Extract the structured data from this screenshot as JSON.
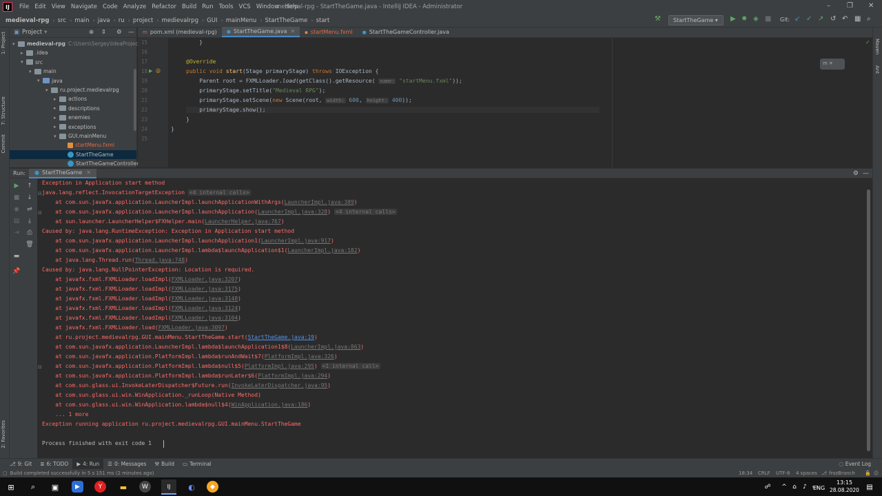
{
  "menubar": {
    "items": [
      "File",
      "Edit",
      "View",
      "Navigate",
      "Code",
      "Analyze",
      "Refactor",
      "Build",
      "Run",
      "Tools",
      "VCS",
      "Window",
      "Help"
    ],
    "window_title": "medieval-rpg - StartTheGame.java - IntelliJ IDEA - Administrator"
  },
  "navbar": {
    "breadcrumbs": [
      "medieval-rpg",
      "src",
      "main",
      "java",
      "ru",
      "project",
      "medievalrpg",
      "GUI",
      "mainMenu",
      "StartTheGame",
      "start"
    ],
    "run_config": "StartTheGame",
    "git_label": "Git:"
  },
  "left_tools": [
    "1: Project",
    "7: Structure",
    "Commit",
    "2: Favorites"
  ],
  "right_tools": [
    "Maven",
    "Ant"
  ],
  "project": {
    "title": "Project",
    "tree": [
      {
        "label": "medieval-rpg",
        "extra": "C:\\Users\\Sergey\\IdeaProjects",
        "depth": 0,
        "kind": "module",
        "open": true
      },
      {
        "label": ".idea",
        "depth": 1,
        "kind": "folder",
        "open": false
      },
      {
        "label": "src",
        "depth": 1,
        "kind": "folder",
        "open": true
      },
      {
        "label": "main",
        "depth": 2,
        "kind": "folder",
        "open": true
      },
      {
        "label": "java",
        "depth": 3,
        "kind": "src",
        "open": true
      },
      {
        "label": "ru.project.medievalrpg",
        "depth": 4,
        "kind": "folder",
        "open": true
      },
      {
        "label": "actions",
        "depth": 5,
        "kind": "folder",
        "open": false
      },
      {
        "label": "descriptions",
        "depth": 5,
        "kind": "folder",
        "open": false
      },
      {
        "label": "enemies",
        "depth": 5,
        "kind": "folder",
        "open": false
      },
      {
        "label": "exceptions",
        "depth": 5,
        "kind": "folder",
        "open": false
      },
      {
        "label": "GUI.mainMenu",
        "depth": 5,
        "kind": "folder",
        "open": true
      },
      {
        "label": "startMenu.fxml",
        "depth": 6,
        "kind": "fxml"
      },
      {
        "label": "StartTheGame",
        "depth": 6,
        "kind": "class",
        "selected": true
      },
      {
        "label": "StartTheGameController",
        "depth": 6,
        "kind": "class"
      }
    ]
  },
  "editor": {
    "tabs": [
      {
        "label": "pom.xml (medieval-rpg)",
        "icon": "m",
        "active": false
      },
      {
        "label": "StartTheGame.java",
        "icon": "c",
        "active": true
      },
      {
        "label": "startMenu.fxml",
        "icon": "fx",
        "active": false
      },
      {
        "label": "StartTheGameController.java",
        "icon": "c",
        "active": false
      }
    ],
    "line_numbers": [
      "15",
      "16",
      "17",
      "18",
      "19",
      "20",
      "21",
      "22",
      "23",
      "24",
      "25"
    ]
  },
  "run": {
    "label": "Run:",
    "tab": "StartTheGame",
    "console": [
      {
        "t": "Exception in Application start method"
      },
      {
        "t": "java.lang.reflect.InvocationTargetException ",
        "ic": "<4 internal calls>"
      },
      {
        "t": "    at com.sun.javafx.application.LauncherImpl.launchApplicationWithArgs(",
        "g": "LauncherImpl.java:389",
        "e": ")"
      },
      {
        "t": "    at com.sun.javafx.application.LauncherImpl.launchApplication(",
        "g": "LauncherImpl.java:328",
        "e": ") ",
        "ic": "<4 internal calls>"
      },
      {
        "t": "    at sun.launcher.LauncherHelper$FXHelper.main(",
        "g": "LauncherHelper.java:767",
        "e": ")"
      },
      {
        "t": "Caused by: java.lang.RuntimeException: Exception in Application start method"
      },
      {
        "t": "    at com.sun.javafx.application.LauncherImpl.launchApplication1(",
        "g": "LauncherImpl.java:917",
        "e": ")"
      },
      {
        "t": "    at com.sun.javafx.application.LauncherImpl.lambda$launchApplication$1(",
        "g": "LauncherImpl.java:182",
        "e": ")"
      },
      {
        "t": "    at java.lang.Thread.run(",
        "g": "Thread.java:748",
        "e": ")"
      },
      {
        "t": "Caused by: java.lang.NullPointerException: Location is required."
      },
      {
        "t": "    at javafx.fxml.FXMLLoader.loadImpl(",
        "g": "FXMLLoader.java:3207",
        "e": ")"
      },
      {
        "t": "    at javafx.fxml.FXMLLoader.loadImpl(",
        "g": "FXMLLoader.java:3175",
        "e": ")"
      },
      {
        "t": "    at javafx.fxml.FXMLLoader.loadImpl(",
        "g": "FXMLLoader.java:3148",
        "e": ")"
      },
      {
        "t": "    at javafx.fxml.FXMLLoader.loadImpl(",
        "g": "FXMLLoader.java:3124",
        "e": ")"
      },
      {
        "t": "    at javafx.fxml.FXMLLoader.loadImpl(",
        "g": "FXMLLoader.java:3104",
        "e": ")"
      },
      {
        "t": "    at javafx.fxml.FXMLLoader.load(",
        "g": "FXMLLoader.java:3097",
        "e": ")"
      },
      {
        "t": "    at ru.project.medievalrpg.GUI.mainMenu.StartTheGame.start(",
        "l": "StartTheGame.java:19",
        "e": ")"
      },
      {
        "t": "    at com.sun.javafx.application.LauncherImpl.lambda$launchApplication1$8(",
        "g": "LauncherImpl.java:863",
        "e": ")"
      },
      {
        "t": "    at com.sun.javafx.application.PlatformImpl.lambda$runAndWait$7(",
        "g": "PlatformImpl.java:326",
        "e": ")"
      },
      {
        "t": "    at com.sun.javafx.application.PlatformImpl.lambda$null$5(",
        "g": "PlatformImpl.java:295",
        "e": ") ",
        "ic": "<1 internal call>"
      },
      {
        "t": "    at com.sun.javafx.application.PlatformImpl.lambda$runLater$6(",
        "g": "PlatformImpl.java:294",
        "e": ")"
      },
      {
        "t": "    at com.sun.glass.ui.InvokeLaterDispatcher$Future.run(",
        "g": "InvokeLaterDispatcher.java:95",
        "e": ")"
      },
      {
        "t": "    at com.sun.glass.ui.win.WinApplication._runLoop(Native Method)"
      },
      {
        "t": "    at com.sun.glass.ui.win.WinApplication.lambda$null$4(",
        "g": "WinApplication.java:186",
        "e": ")"
      },
      {
        "t": "    ... 1 more"
      },
      {
        "t": "Exception running application ru.project.medievalrpg.GUI.mainMenu.StartTheGame"
      },
      {
        "t": ""
      },
      {
        "t": "Process finished with exit code 1",
        "norm": true
      }
    ]
  },
  "bottom_tools": [
    "9: Git",
    "6: TODO",
    "4: Run",
    "0: Messages",
    "Build",
    "Terminal"
  ],
  "event_log": "Event Log",
  "status": {
    "message": "Build completed successfully in 5 s 151 ms (2 minutes ago)",
    "position": "18:34",
    "line_sep": "CRLF",
    "encoding": "UTF-8",
    "indent": "4 spaces",
    "branch": "frozBranch"
  },
  "taskbar": {
    "lang": "ENG",
    "time": "13:15",
    "date": "28.08.2020"
  }
}
